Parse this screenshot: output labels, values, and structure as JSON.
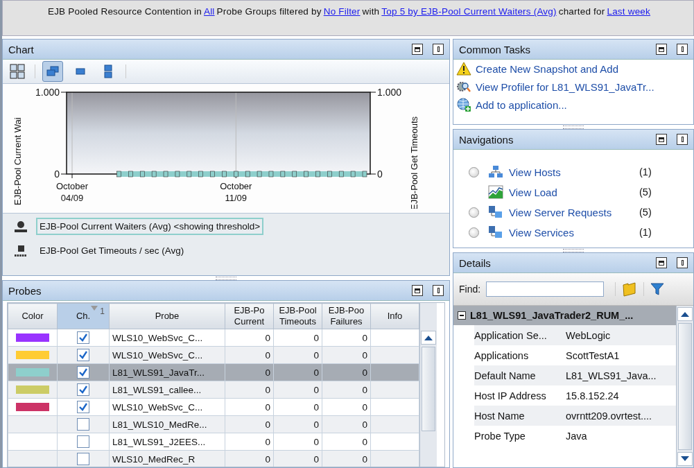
{
  "header": {
    "parts": [
      {
        "kind": "text",
        "text": "EJB Pooled Resource Contention in"
      },
      {
        "kind": "link",
        "text": "All"
      },
      {
        "kind": "text",
        "text": "Probe Groups filtered by"
      },
      {
        "kind": "link",
        "text": "No Filter"
      },
      {
        "kind": "text",
        "text": "with"
      },
      {
        "kind": "link",
        "text": "Top 5 by EJB-Pool Current Waiters (Avg)"
      },
      {
        "kind": "text",
        "text": "charted for"
      },
      {
        "kind": "link",
        "text": "Last week"
      }
    ]
  },
  "chart_panel": {
    "title": "Chart",
    "toolbar": [
      {
        "kind": "grid",
        "selected": false
      },
      {
        "kind": "overlay",
        "selected": true
      },
      {
        "kind": "single",
        "selected": false
      },
      {
        "kind": "stacked",
        "selected": false
      }
    ],
    "chart_data": {
      "type": "line",
      "ylabel": "EJB-Pool Current Wai",
      "y2label": "EJB-Pool Get Timeouts",
      "ylim": [
        0,
        1000
      ],
      "yticks": [
        {
          "value": 0,
          "label": "0"
        },
        {
          "value": 1000,
          "label": "1.000"
        }
      ],
      "categories": [
        "October 04/09",
        null,
        null,
        null,
        null,
        null,
        null,
        null,
        null,
        null,
        null,
        null,
        null,
        null,
        "October 11/09",
        null,
        null,
        null,
        null,
        null,
        null,
        null,
        null,
        null,
        null,
        null
      ],
      "series": [
        {
          "name": "EJB-Pool Current Waiters (Avg)",
          "color": "#8ecfcc",
          "marker": "square",
          "values": [
            null,
            null,
            null,
            null,
            0,
            0,
            0,
            0,
            0,
            0,
            0,
            0,
            0,
            0,
            0,
            0,
            0,
            0,
            0,
            0,
            0,
            0,
            0,
            0,
            0,
            0
          ]
        }
      ]
    },
    "legend": [
      {
        "kind": "series",
        "suffix": "<showing threshold>",
        "selected": true
      },
      {
        "kind": "bar",
        "label": "EJB-Pool Get Timeouts / sec (Avg)",
        "selected": false
      }
    ]
  },
  "probes_panel": {
    "title": "Probes",
    "columns": [
      {
        "lines": [
          "Color"
        ]
      },
      {
        "lines": [
          "Ch."
        ],
        "sort": "1"
      },
      {
        "lines": [
          "Probe"
        ]
      },
      {
        "lines": [
          "EJB-Po",
          "Current"
        ]
      },
      {
        "lines": [
          "EJB-Pool",
          "Timeouts"
        ]
      },
      {
        "lines": [
          "EJB-Poo",
          "Failures"
        ]
      },
      {
        "lines": [
          "Info"
        ]
      }
    ],
    "rows": [
      {
        "color": "#9933ff",
        "checked": true,
        "selected": false,
        "probe": "WLS10_WebSvc_C...",
        "values": [
          "0",
          "0",
          "0"
        ]
      },
      {
        "color": "#ffcc33",
        "checked": true,
        "selected": false,
        "probe": "WLS10_WebSvc_C...",
        "values": [
          "0",
          "0",
          "0"
        ]
      },
      {
        "color": "#8ecfcc",
        "checked": true,
        "selected": true,
        "probe": "L81_WLS91_JavaTr...",
        "values": [
          "0",
          "0",
          "0"
        ]
      },
      {
        "color": "#cccc66",
        "checked": true,
        "selected": false,
        "probe": "L81_WLS91_callee...",
        "values": [
          "0",
          "0",
          "0"
        ]
      },
      {
        "color": "#cc3366",
        "checked": true,
        "selected": false,
        "probe": "WLS10_WebSvc_C...",
        "values": [
          "0",
          "0",
          "0"
        ]
      },
      {
        "checked": false,
        "selected": false,
        "probe": "L81_WLS10_MedRe...",
        "values": [
          "0",
          "0",
          "0"
        ]
      },
      {
        "checked": false,
        "selected": false,
        "probe": "L81_WLS91_J2EES...",
        "values": [
          "0",
          "0",
          "0"
        ]
      },
      {
        "checked": false,
        "selected": false,
        "probe": "WLS10_MedRec_R",
        "values": [
          "0",
          "0",
          "0"
        ]
      }
    ]
  },
  "common_tasks": {
    "title": "Common Tasks",
    "items": [
      {
        "kind": "warning",
        "label": "Create New Snapshot and Add"
      },
      {
        "kind": "profiler",
        "label": "View Profiler for L81_WLS91_JavaTr..."
      },
      {
        "kind": "add",
        "label": "Add to application..."
      }
    ]
  },
  "navigations": {
    "title": "Navigations",
    "items": [
      {
        "kind": "hosts",
        "selected": false,
        "label": "View Hosts",
        "count": "(1)"
      },
      {
        "kind": "load",
        "label": "View Load",
        "count": "(5)"
      },
      {
        "kind": "requests",
        "selected": false,
        "label": "View Server Requests",
        "count": "(5)"
      },
      {
        "kind": "services",
        "selected": false,
        "label": "View Services",
        "count": "(1)"
      }
    ]
  },
  "details": {
    "title": "Details",
    "find_label": "Find:",
    "group": {
      "label": "L81_WLS91_JavaTrader2_RUM_...",
      "expanded": true,
      "children": [
        {
          "name": "Application Se...",
          "value": "WebLogic"
        },
        {
          "name": "Applications",
          "value": "ScottTestA1"
        },
        {
          "name": "Default Name",
          "value": "L81_WLS91_Java..."
        },
        {
          "name": "Host IP Address",
          "value": "15.8.152.24"
        },
        {
          "name": "Host Name",
          "value": "ovrntt209.ovrtest...."
        },
        {
          "name": "Probe Type",
          "value": "Java"
        }
      ]
    }
  }
}
